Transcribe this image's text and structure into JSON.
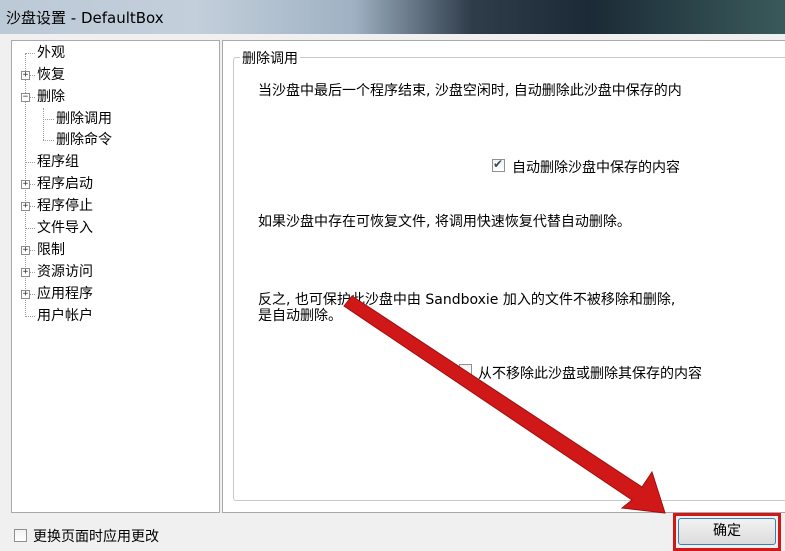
{
  "window": {
    "title": "沙盘设置 - DefaultBox"
  },
  "tree": {
    "items": [
      {
        "label": "外观"
      },
      {
        "label": "恢复"
      },
      {
        "label": "删除"
      },
      {
        "label": "删除调用"
      },
      {
        "label": "删除命令"
      },
      {
        "label": "程序组"
      },
      {
        "label": "程序启动"
      },
      {
        "label": "程序停止"
      },
      {
        "label": "文件导入"
      },
      {
        "label": "限制"
      },
      {
        "label": "资源访问"
      },
      {
        "label": "应用程序"
      },
      {
        "label": "用户帐户"
      }
    ],
    "expander_plus": "+",
    "expander_minus": "−"
  },
  "panel": {
    "group_title": "删除调用",
    "text1": "当沙盘中最后一个程序结束, 沙盘空闲时, 自动删除此沙盘中保存的内",
    "auto_delete": {
      "label": "自动删除沙盘中保存的内容",
      "checked": true
    },
    "text2": "如果沙盘中存在可恢复文件, 将调用快速恢复代替自动删除。",
    "text3_line1": "反之, 也可保护此沙盘中由 Sandboxie 加入的文件不被移除和删除,",
    "text3_line2": "是自动删除。",
    "never_remove": {
      "label": "从不移除此沙盘或删除其保存的内容",
      "checked": false
    }
  },
  "footer": {
    "apply_on_change": {
      "label": "更换页面时应用更改",
      "checked": false
    },
    "ok_label": "确定"
  },
  "colors": {
    "highlight": "#d01818",
    "arrow": "#d01818"
  }
}
